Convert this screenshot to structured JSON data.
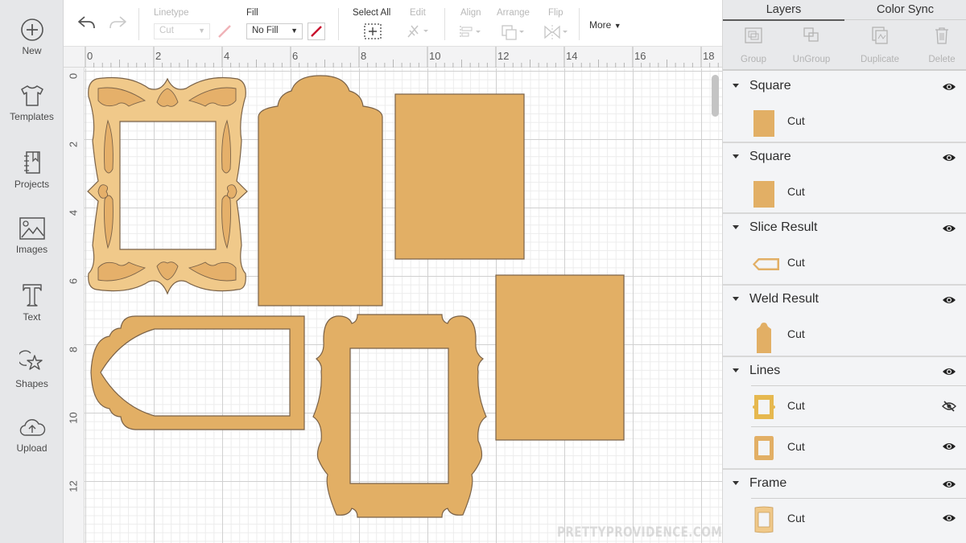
{
  "app": {
    "accent_shape_color": "#e2af65",
    "shape_stroke": "#7a6248"
  },
  "leftnav": {
    "items": [
      {
        "label": "New",
        "icon": "plus-circle-icon"
      },
      {
        "label": "Templates",
        "icon": "tshirt-icon"
      },
      {
        "label": "Projects",
        "icon": "notebook-icon"
      },
      {
        "label": "Images",
        "icon": "image-icon"
      },
      {
        "label": "Text",
        "icon": "text-t-icon"
      },
      {
        "label": "Shapes",
        "icon": "shapes-icon"
      },
      {
        "label": "Upload",
        "icon": "cloud-upload-icon"
      }
    ]
  },
  "toolbar": {
    "linetype_label": "Linetype",
    "linetype_value": "Cut",
    "fill_label": "Fill",
    "fill_value": "No Fill",
    "select_all_label": "Select All",
    "edit_label": "Edit",
    "align_label": "Align",
    "arrange_label": "Arrange",
    "flip_label": "Flip",
    "more_label": "More"
  },
  "rulers": {
    "unit": "inches",
    "top": [
      "0",
      "2",
      "4",
      "6",
      "8",
      "10",
      "12",
      "14",
      "16",
      "18"
    ],
    "left": [
      "0",
      "2",
      "4",
      "6",
      "8",
      "10",
      "12"
    ]
  },
  "canvas": {
    "watermark": "PRETTYPROVIDENCE.COM"
  },
  "panel": {
    "tabs": [
      {
        "label": "Layers",
        "active": true
      },
      {
        "label": "Color Sync",
        "active": false
      }
    ],
    "actions": [
      {
        "label": "Group",
        "enabled": false
      },
      {
        "label": "UnGroup",
        "enabled": false
      },
      {
        "label": "Duplicate",
        "enabled": false
      },
      {
        "label": "Delete",
        "enabled": false
      }
    ],
    "layers": [
      {
        "name": "Square",
        "visible": true,
        "children": [
          {
            "label": "Cut",
            "thumb": "rect",
            "visible": true
          }
        ]
      },
      {
        "name": "Square",
        "visible": true,
        "children": [
          {
            "label": "Cut",
            "thumb": "rect",
            "visible": true
          }
        ]
      },
      {
        "name": "Slice Result",
        "visible": true,
        "children": [
          {
            "label": "Cut",
            "thumb": "tag-outline",
            "visible": true
          }
        ]
      },
      {
        "name": "Weld Result",
        "visible": true,
        "children": [
          {
            "label": "Cut",
            "thumb": "arch-tag",
            "visible": true
          }
        ]
      },
      {
        "name": "Lines",
        "visible": true,
        "children": [
          {
            "label": "Cut",
            "thumb": "frame-yellow",
            "visible": false
          },
          {
            "label": "Cut",
            "thumb": "frame-orange",
            "visible": true
          }
        ]
      },
      {
        "name": "Frame",
        "visible": true,
        "children": [
          {
            "label": "Cut",
            "thumb": "frame-ornate",
            "visible": true
          }
        ]
      }
    ]
  }
}
